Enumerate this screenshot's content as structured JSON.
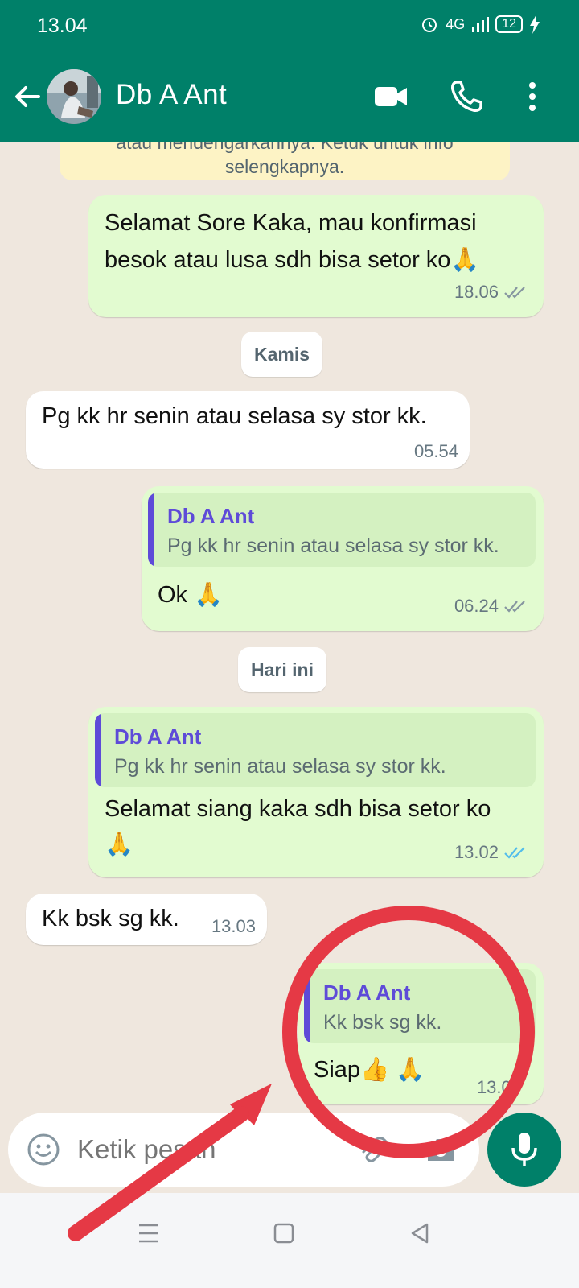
{
  "status_bar": {
    "time": "13.04",
    "network": "4G",
    "battery": "12"
  },
  "header": {
    "contact_name": "Db A Ant"
  },
  "notice": {
    "line1": "atau mendengarkannya. Ketuk untuk info",
    "line2": "selengkapnya."
  },
  "messages": [
    {
      "direction": "out",
      "text_line1": "Selamat Sore Kaka, mau konfirmasi",
      "text_line2": "besok atau lusa sdh bisa setor ko🙏",
      "time": "18.06",
      "status": "read"
    },
    {
      "type": "date",
      "label": "Kamis"
    },
    {
      "direction": "in",
      "text": "Pg kk hr senin atau selasa sy stor kk.",
      "time": "05.54"
    },
    {
      "direction": "out",
      "quote_name": "Db A Ant",
      "quote_text": "Pg kk hr senin atau selasa sy stor kk.",
      "text": "Ok 🙏",
      "time": "06.24",
      "status": "delivered"
    },
    {
      "type": "date",
      "label": "Hari ini"
    },
    {
      "direction": "out",
      "quote_name": "Db A Ant",
      "quote_text": "Pg kk hr senin atau selasa sy stor kk.",
      "text_line1": "Selamat siang kaka sdh bisa setor ko",
      "text_line2": "🙏",
      "time": "13.02",
      "status": "read"
    },
    {
      "direction": "in",
      "text": "Kk bsk sg kk.",
      "time": "13.03"
    },
    {
      "direction": "out",
      "quote_name": "Db A Ant",
      "quote_text": "Kk bsk sg kk.",
      "text": "Siap👍 🙏",
      "time": "13.04",
      "status": "sent"
    }
  ],
  "composer": {
    "placeholder": "Ketik pesan"
  },
  "colors": {
    "header": "#008069",
    "outgoing_bubble": "#e2fbd0",
    "incoming_bubble": "#ffffff",
    "quote_accent": "#5e4bd8",
    "read_tick": "#53bdeb",
    "annotation": "#e53945"
  }
}
